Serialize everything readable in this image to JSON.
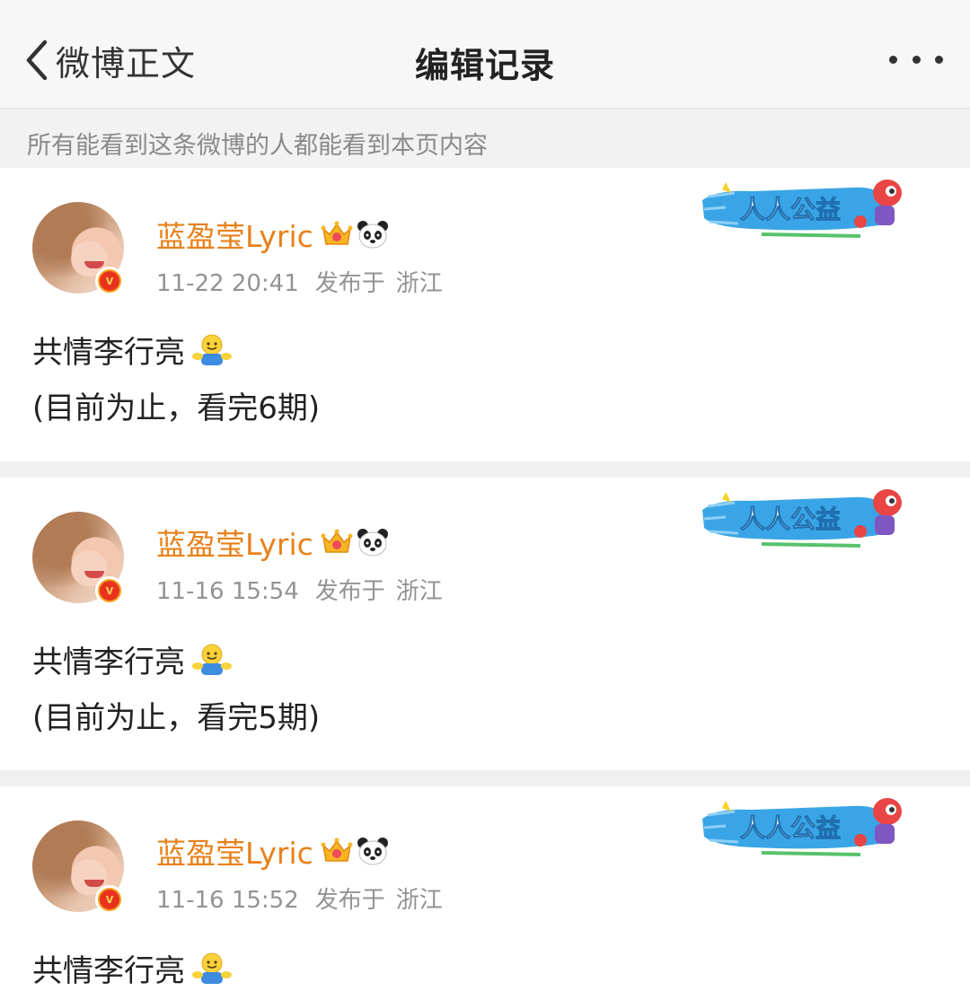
{
  "header": {
    "back_label": "微博正文",
    "title": "编辑记录"
  },
  "notice": "所有能看到这条微博的人都能看到本页内容",
  "colors": {
    "username": "#e8811a",
    "meta": "#939393",
    "charity_blue": "#3aa5e6",
    "vip_badge": "#f4a21d"
  },
  "icons": {
    "back": "chevron-left-icon",
    "more": "more-dots-icon",
    "verified": "verified-v-badge-icon",
    "member": "crown-icon",
    "panda": "panda-icon",
    "hug": "hug-emoji-icon"
  },
  "records": [
    {
      "username": "蓝盈莹Lyric",
      "time": "11-22 20:41",
      "loc_label": "发布于",
      "loc": "浙江",
      "charity_label": "人人公益",
      "verified_mark": "v",
      "lines": [
        "共情李行亮",
        "(目前为止，看完6期)"
      ]
    },
    {
      "username": "蓝盈莹Lyric",
      "time": "11-16 15:54",
      "loc_label": "发布于",
      "loc": "浙江",
      "charity_label": "人人公益",
      "verified_mark": "v",
      "lines": [
        "共情李行亮",
        "(目前为止，看完5期)"
      ]
    },
    {
      "username": "蓝盈莹Lyric",
      "time": "11-16 15:52",
      "loc_label": "发布于",
      "loc": "浙江",
      "charity_label": "人人公益",
      "verified_mark": "v",
      "lines": [
        "共情李行亮"
      ]
    }
  ]
}
